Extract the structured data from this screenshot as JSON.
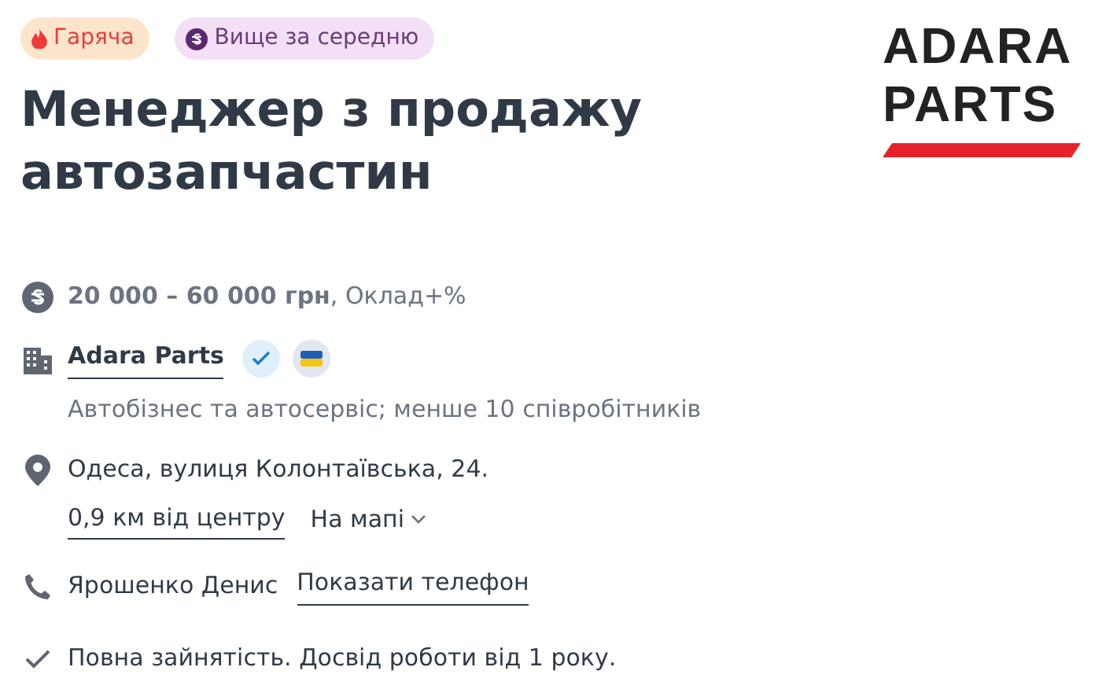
{
  "tags": [
    {
      "kind": "hot",
      "label": "Гаряча"
    },
    {
      "kind": "salary",
      "label": "Вище за середню"
    }
  ],
  "logo": {
    "lines": [
      "ADARA",
      "PARTS"
    ]
  },
  "title": "Менеджер з продажу автозапчастин",
  "salary": "**20 000 – 60 000 грн**, Оклад+%",
  "company": {
    "name": "Adara Parts",
    "description": "Автобізнес та автосервіс; менше 10 співробітників"
  },
  "address": {
    "text": "Одеса, вулиця Колонтаївська, 24.",
    "distance": "0,9 км від центру",
    "map_link": "На мапі"
  },
  "contact": {
    "name": "Ярошенко Денис",
    "phone_link": "Показати телефон"
  },
  "conditions": "Повна зайнятість. Досвід роботи від 1 року."
}
